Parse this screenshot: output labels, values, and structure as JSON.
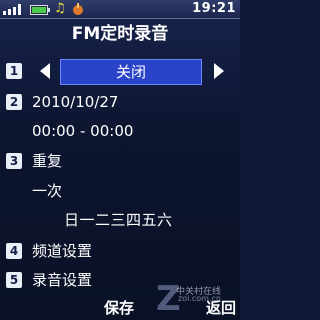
{
  "status": {
    "time": "19:21",
    "icons": [
      "signal-icon",
      "battery-icon",
      "music-note-icon",
      "fm-radio-icon"
    ]
  },
  "title": "FM定时录音",
  "rows": [
    {
      "num": "1",
      "value": "关闭"
    },
    {
      "num": "2",
      "date": "2010/10/27",
      "time_range": "00:00 - 00:00"
    },
    {
      "num": "3",
      "label": "重复",
      "repeat_value": "一次",
      "weekdays": "日一二三四五六"
    },
    {
      "num": "4",
      "label": "频道设置"
    },
    {
      "num": "5",
      "label": "录音设置"
    }
  ],
  "softkeys": {
    "left": "保存",
    "right": "返回"
  },
  "watermark": {
    "text1": "中关村在线",
    "text2": "zol.com.cn"
  },
  "colors": {
    "highlight": "#2a44c9",
    "background": "#0e1733",
    "status_bar": "#2f3d69"
  }
}
